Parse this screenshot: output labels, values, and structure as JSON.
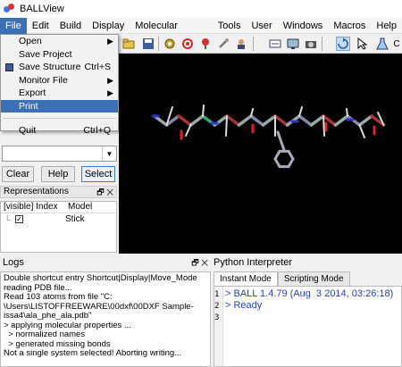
{
  "window": {
    "title": "BALLView"
  },
  "menubar": [
    "File",
    "Edit",
    "Build",
    "Display",
    "Molecular Mechanics",
    "Tools",
    "User",
    "Windows",
    "Macros",
    "Help"
  ],
  "file_menu": {
    "items": [
      {
        "label": "Open",
        "shortcut": "",
        "submenu": true
      },
      {
        "label": "Save Project",
        "shortcut": "",
        "submenu": false
      },
      {
        "label": "Save Structure",
        "shortcut": "Ctrl+S",
        "submenu": false
      },
      {
        "label": "Monitor File",
        "shortcut": "",
        "submenu": true
      },
      {
        "label": "Export",
        "shortcut": "",
        "submenu": true
      },
      {
        "label": "Print",
        "shortcut": "",
        "submenu": false
      },
      {
        "label": "Quit",
        "shortcut": "Ctrl+Q",
        "submenu": false
      }
    ]
  },
  "toolbar": {
    "icons": [
      "open-icon",
      "save-icon",
      "settings-icon",
      "target-icon",
      "pin-icon",
      "wrench-icon",
      "distance-icon",
      "screen-icon",
      "camera-icon",
      "rotate-icon",
      "select-icon",
      "flask-icon"
    ]
  },
  "left_panel": {
    "buttons": {
      "clear": "Clear",
      "help": "Help",
      "select": "Select"
    },
    "representations": {
      "title": "Representations",
      "columns": [
        "[visible] Index",
        "Model"
      ],
      "rows": [
        {
          "checked": true,
          "model": "Stick"
        }
      ]
    }
  },
  "logs": {
    "title": "Logs",
    "lines": [
      "Double shortcut entry Shortcut|Display|Move_Mode",
      "reading PDB file...",
      "Read 103 atoms from file \"C:",
      "\\Users\\LISTOFFREEWARE\\00dxf\\00DXF Sample-",
      "issa4\\ala_phe_ala.pdb\"",
      "> applying molecular properties ...",
      "  > normalized names",
      "  > generated missing bonds",
      "Not a single system selected! Aborting writing..."
    ]
  },
  "python": {
    "title": "Python Interpreter",
    "tabs": [
      "Instant Mode",
      "Scripting Mode"
    ],
    "lines": [
      {
        "num": "1",
        "text": "> BALL 1.4.79 (Aug  3 2014, 03:26:18)"
      },
      {
        "num": "2",
        "text": "> Ready"
      },
      {
        "num": "3",
        "text": ""
      }
    ]
  },
  "colors": {
    "accent": "#3c6fb6",
    "console_text": "#2a42c8",
    "viewer_bg": "#000000"
  }
}
